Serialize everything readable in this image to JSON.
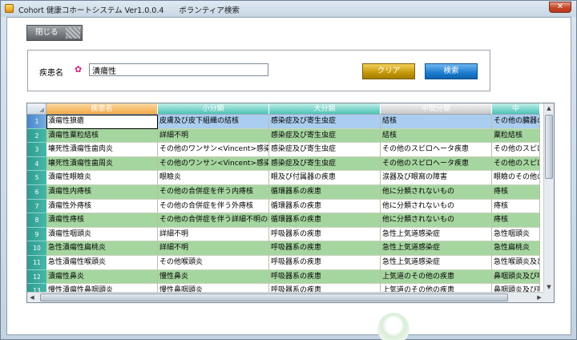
{
  "window": {
    "title": "Cohort 健康コホートシステム Ver1.0.0.4　　ボランティア検索",
    "close_glyph": "✕"
  },
  "toolbar": {
    "close_label": "閉じる"
  },
  "search": {
    "label": "疾患名",
    "required_marker": "✿",
    "value": "潰瘍性",
    "clear_label": "クリア",
    "search_label": "検索"
  },
  "grid": {
    "columns": [
      "疾患名",
      "小分類",
      "大分類",
      "中間分類",
      "中"
    ],
    "rows": [
      {
        "num": "1",
        "cells": [
          "潰瘍性狼瘡",
          "皮膚及び皮下組織の結核",
          "感染症及び寄生虫症",
          "結核",
          "その他の臓器の結核"
        ]
      },
      {
        "num": "2",
        "cells": [
          "潰瘍性粟粒結核",
          "詳細不明",
          "感染症及び寄生虫症",
          "結核",
          "粟粒結核"
        ]
      },
      {
        "num": "3",
        "cells": [
          "壊死性潰瘍性歯肉炎",
          "その他のワンサン<Vincent>感染症",
          "感染症及び寄生虫症",
          "その他のスピロヘータ疾患",
          "その他のスピロヘータ"
        ]
      },
      {
        "num": "4",
        "cells": [
          "壊死性潰瘍性歯周炎",
          "その他のワンサン<Vincent>感染症",
          "感染症及び寄生虫症",
          "その他のスピロヘータ疾患",
          "その他のスピロヘータ"
        ]
      },
      {
        "num": "5",
        "cells": [
          "潰瘍性眼瞼炎",
          "眼瞼炎",
          "眼及び付属器の疾患",
          "涙器及び眼窩の障害",
          "眼瞼のその他の炎症"
        ]
      },
      {
        "num": "6",
        "cells": [
          "潰瘍性内痔核",
          "その他の合併症を伴う内痔核",
          "循環器系の疾患",
          "他に分類されないもの",
          "痔核"
        ]
      },
      {
        "num": "7",
        "cells": [
          "潰瘍性外痔核",
          "その他の合併症を伴う外痔核",
          "循環器系の疾患",
          "他に分類されないもの",
          "痔核"
        ]
      },
      {
        "num": "8",
        "cells": [
          "潰瘍性痔核",
          "その他の合併症を伴う詳細不明の痔核",
          "循環器系の疾患",
          "他に分類されないもの",
          "痔核"
        ]
      },
      {
        "num": "9",
        "cells": [
          "潰瘍性咽頭炎",
          "詳細不明",
          "呼吸器系の疾患",
          "急性上気道感染症",
          "急性咽頭炎"
        ]
      },
      {
        "num": "10",
        "cells": [
          "急性潰瘍性扁桃炎",
          "詳細不明",
          "呼吸器系の疾患",
          "急性上気道感染症",
          "急性扁桃炎"
        ]
      },
      {
        "num": "11",
        "cells": [
          "急性潰瘍性喉頭炎",
          "その他喉頭炎",
          "呼吸器系の疾患",
          "急性上気道感染症",
          "急性喉頭炎及び気"
        ]
      },
      {
        "num": "12",
        "cells": [
          "潰瘍性鼻炎",
          "慢性鼻炎",
          "呼吸器系の疾患",
          "上気道のその他の疾患",
          "鼻咽頭炎及び咽頭"
        ]
      },
      {
        "num": "13",
        "cells": [
          "慢性潰瘍性鼻咽頭炎",
          "慢性鼻咽頭炎",
          "呼吸器系の疾患",
          "上気道のその他の疾患",
          "鼻咽頭炎及び咽頭"
        ]
      }
    ],
    "selected_row": 0
  }
}
